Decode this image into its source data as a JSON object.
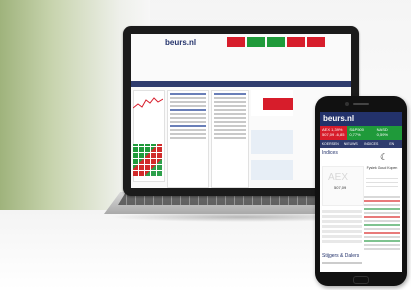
{
  "laptop_site": {
    "logo": "beurs.nl",
    "ticker_colors": [
      "#d71d2b",
      "#1f9a3a",
      "#1f9a3a",
      "#d71d2b",
      "#d71d2b"
    ]
  },
  "phone_site": {
    "logo": "beurs.nl",
    "tickers": [
      {
        "name": "AEX",
        "change": "1,39%",
        "detail": "507,09 -6,85",
        "color": "#d71d2b"
      },
      {
        "name": "S&P500",
        "change": "0,77%",
        "detail": "",
        "color": "#1f9a3a"
      },
      {
        "name": "NASD",
        "change": "0,59%",
        "detail": "",
        "color": "#1f9a3a"
      }
    ],
    "tabs": [
      "KOERSEN",
      "NIEUWS",
      "INDICES",
      "EN"
    ],
    "section_title": "Indices",
    "aex_label": "AEX",
    "aex_value": "507,09",
    "side_heading": "Fysiek Goud Kopen",
    "bottom_title": "Stijgers & Dalers"
  },
  "colors": {
    "brand": "#23326b",
    "nav": "#2f3c6e",
    "up": "#1f9a3a",
    "down": "#d71d2b"
  }
}
